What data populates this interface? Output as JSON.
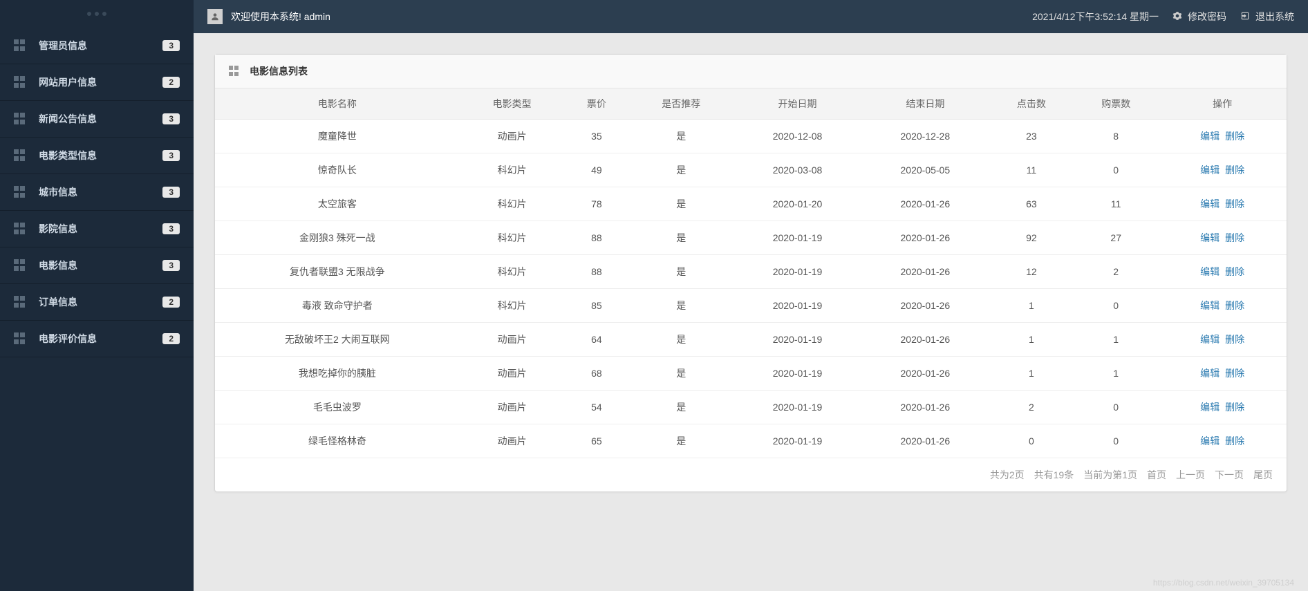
{
  "header": {
    "welcome": "欢迎使用本系统! admin",
    "clock": "2021/4/12下午3:52:14 星期一",
    "change_password": "修改密码",
    "logout": "退出系统"
  },
  "sidebar": {
    "items": [
      {
        "label": "管理员信息",
        "badge": "3"
      },
      {
        "label": "网站用户信息",
        "badge": "2"
      },
      {
        "label": "新闻公告信息",
        "badge": "3"
      },
      {
        "label": "电影类型信息",
        "badge": "3"
      },
      {
        "label": "城市信息",
        "badge": "3"
      },
      {
        "label": "影院信息",
        "badge": "3"
      },
      {
        "label": "电影信息",
        "badge": "3"
      },
      {
        "label": "订单信息",
        "badge": "2"
      },
      {
        "label": "电影评价信息",
        "badge": "2"
      }
    ]
  },
  "panel": {
    "title": "电影信息列表"
  },
  "table": {
    "columns": [
      "电影名称",
      "电影类型",
      "票价",
      "是否推荐",
      "开始日期",
      "结束日期",
      "点击数",
      "购票数",
      "操作"
    ],
    "actions": {
      "edit": "编辑",
      "delete": "删除"
    },
    "rows": [
      {
        "name": "魔童降世",
        "type": "动画片",
        "price": "35",
        "recommend": "是",
        "start": "2020-12-08",
        "end": "2020-12-28",
        "clicks": "23",
        "tickets": "8"
      },
      {
        "name": "惊奇队长",
        "type": "科幻片",
        "price": "49",
        "recommend": "是",
        "start": "2020-03-08",
        "end": "2020-05-05",
        "clicks": "11",
        "tickets": "0"
      },
      {
        "name": "太空旅客",
        "type": "科幻片",
        "price": "78",
        "recommend": "是",
        "start": "2020-01-20",
        "end": "2020-01-26",
        "clicks": "63",
        "tickets": "11"
      },
      {
        "name": "金刚狼3 殊死一战",
        "type": "科幻片",
        "price": "88",
        "recommend": "是",
        "start": "2020-01-19",
        "end": "2020-01-26",
        "clicks": "92",
        "tickets": "27"
      },
      {
        "name": "复仇者联盟3 无限战争",
        "type": "科幻片",
        "price": "88",
        "recommend": "是",
        "start": "2020-01-19",
        "end": "2020-01-26",
        "clicks": "12",
        "tickets": "2"
      },
      {
        "name": "毒液 致命守护者",
        "type": "科幻片",
        "price": "85",
        "recommend": "是",
        "start": "2020-01-19",
        "end": "2020-01-26",
        "clicks": "1",
        "tickets": "0"
      },
      {
        "name": "无敌破坏王2 大闹互联网",
        "type": "动画片",
        "price": "64",
        "recommend": "是",
        "start": "2020-01-19",
        "end": "2020-01-26",
        "clicks": "1",
        "tickets": "1"
      },
      {
        "name": "我想吃掉你的胰脏",
        "type": "动画片",
        "price": "68",
        "recommend": "是",
        "start": "2020-01-19",
        "end": "2020-01-26",
        "clicks": "1",
        "tickets": "1"
      },
      {
        "name": "毛毛虫波罗",
        "type": "动画片",
        "price": "54",
        "recommend": "是",
        "start": "2020-01-19",
        "end": "2020-01-26",
        "clicks": "2",
        "tickets": "0"
      },
      {
        "name": "绿毛怪格林奇",
        "type": "动画片",
        "price": "65",
        "recommend": "是",
        "start": "2020-01-19",
        "end": "2020-01-26",
        "clicks": "0",
        "tickets": "0"
      }
    ]
  },
  "pagination": {
    "total_pages": "共为2页",
    "total_items": "共有19条",
    "current": "当前为第1页",
    "first": "首页",
    "prev": "上一页",
    "next": "下一页",
    "last": "尾页"
  },
  "watermark": "https://blog.csdn.net/weixin_39705134"
}
